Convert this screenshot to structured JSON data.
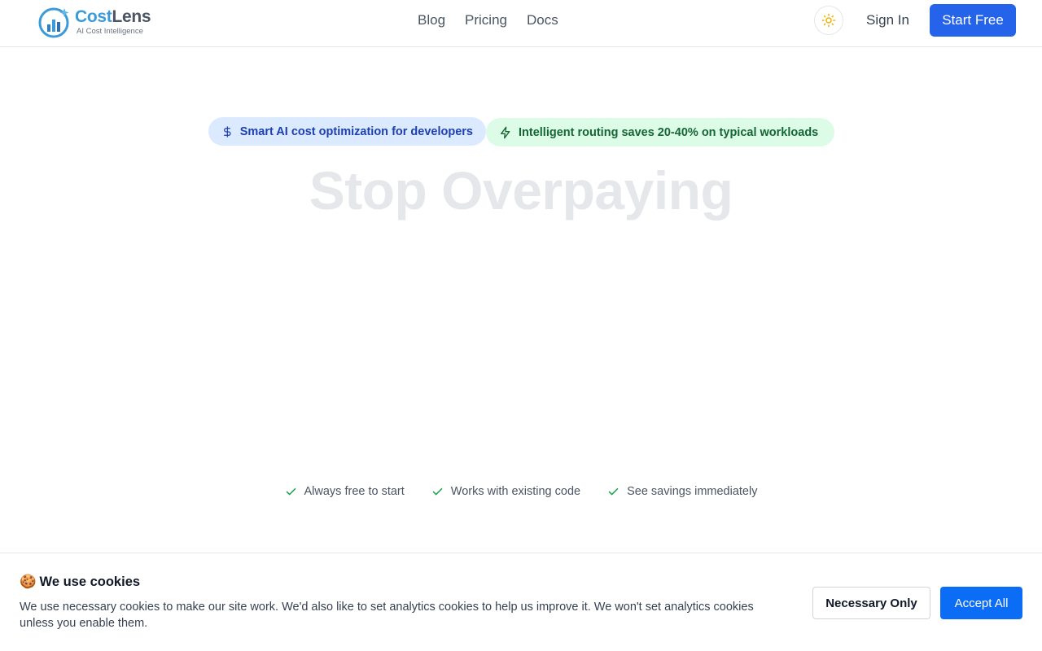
{
  "header": {
    "logo": {
      "name_part1": "Cost",
      "name_part2": "Lens",
      "tagline": "AI Cost Intelligence"
    },
    "nav": [
      {
        "label": "Blog"
      },
      {
        "label": "Pricing"
      },
      {
        "label": "Docs"
      }
    ],
    "theme_icon": "sun-icon",
    "sign_in_label": "Sign In",
    "start_free_label": "Start Free"
  },
  "hero": {
    "badges": [
      {
        "label": "Smart AI cost optimization for developers",
        "icon": "dollar-icon"
      },
      {
        "label": "Intelligent routing saves 20-40% on typical workloads",
        "icon": "lightning-icon"
      }
    ],
    "title": "Stop Overpaying",
    "features": [
      {
        "label": "Always free to start",
        "icon": "check-icon"
      },
      {
        "label": "Works with existing code",
        "icon": "check-icon"
      },
      {
        "label": "See savings immediately",
        "icon": "check-icon"
      }
    ]
  },
  "cookie_banner": {
    "emoji": "🍪",
    "title": "We use cookies",
    "text": "We use necessary cookies to make our site work. We'd also like to set analytics cookies to help us improve it. We won't set analytics cookies unless you enable them.",
    "necessary_label": "Necessary Only",
    "accept_label": "Accept All"
  },
  "colors": {
    "primary": "#2563eb",
    "accept": "#0b6cf6",
    "badge_blue_bg": "#dbeafe",
    "badge_green_bg": "#dcfce7",
    "check": "#16a34a"
  }
}
